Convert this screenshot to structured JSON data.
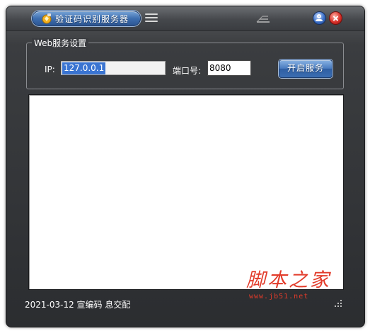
{
  "window": {
    "title": "验证码识别服务器",
    "icons": {
      "app": "app-icon",
      "menu": "menu-icon",
      "skin": "skin-icon",
      "minimize": "user-minimize-icon",
      "close": "close-icon"
    }
  },
  "web_service": {
    "group_title": "Web服务设置",
    "ip_label": "IP:",
    "ip_value": "127.0.0.1",
    "port_label": "端口号:",
    "port_value": "8080",
    "start_button": "开启服务"
  },
  "log": {
    "lines": []
  },
  "status": {
    "text": "2021-03-12 宣编码  息交配"
  },
  "watermark": {
    "main": "脚本之家",
    "sub": "www.jb51.net"
  },
  "colors": {
    "accent_blue": "#3e6fb0",
    "close_red": "#d8302a",
    "selection": "#3a74d1",
    "watermark": "#e23b2a"
  }
}
